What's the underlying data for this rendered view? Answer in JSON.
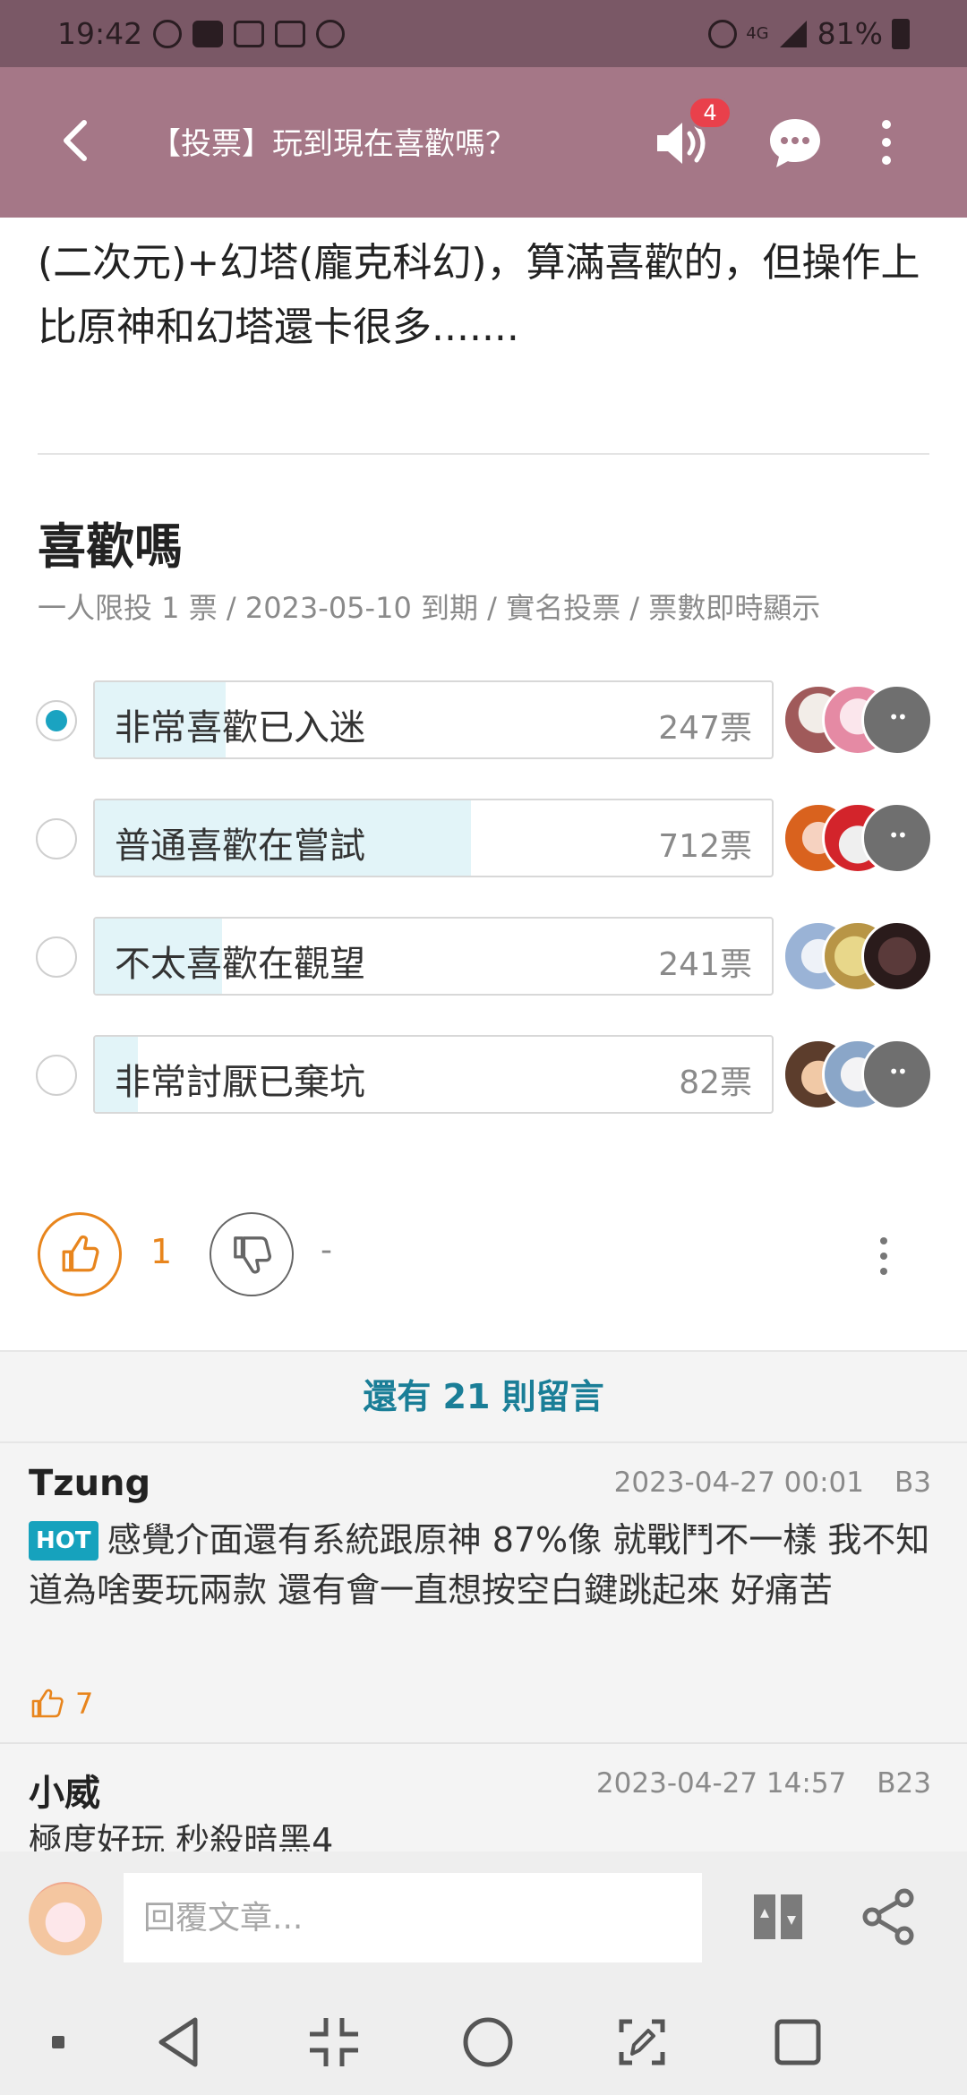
{
  "status_bar": {
    "time": "19:42",
    "signal_label": "4G",
    "battery": "81%"
  },
  "app_bar": {
    "title": "【投票】玩到現在喜歡嗎？",
    "notification_count": "4"
  },
  "article": {
    "text": "(二次元)+幻塔(龐克科幻)，算滿喜歡的，但操作上比原神和幻塔還卡很多......."
  },
  "poll": {
    "title": "喜歡嗎",
    "meta": "一人限投 1 票 / 2023-05-10 到期 / 實名投票 / 票數即時顯示",
    "options": [
      {
        "label": "非常喜歡已入迷",
        "votes": "247票",
        "count": 247,
        "selected": true
      },
      {
        "label": "普通喜歡在嘗試",
        "votes": "712票",
        "count": 712,
        "selected": false
      },
      {
        "label": "不太喜歡在觀望",
        "votes": "241票",
        "count": 241,
        "selected": false
      },
      {
        "label": "非常討厭已棄坑",
        "votes": "82票",
        "count": 82,
        "selected": false
      }
    ]
  },
  "post_actions": {
    "like_count": "1",
    "dislike_count": "-"
  },
  "more_comments": "還有 21 則留言",
  "comments": [
    {
      "author": "Tzung",
      "date": "2023-04-27 00:01",
      "floor": "B3",
      "badge": "HOT",
      "body": "感覺介面還有系統跟原神 87%像 就戰鬥不一樣 我不知道為啥要玩兩款 還有會一直想按空白鍵跳起來 好痛苦",
      "likes": "7"
    },
    {
      "author": "小威",
      "date": "2023-04-27 14:57",
      "floor": "B23",
      "body": "極度好玩 秒殺暗黑4"
    }
  ],
  "reply_bar": {
    "placeholder": "回覆文章..."
  },
  "colors": {
    "status_bar": "#7a5866",
    "app_bar": "#a57787",
    "accent": "#1aa3c1",
    "like": "#e8851d",
    "badge": "#e9404b"
  }
}
